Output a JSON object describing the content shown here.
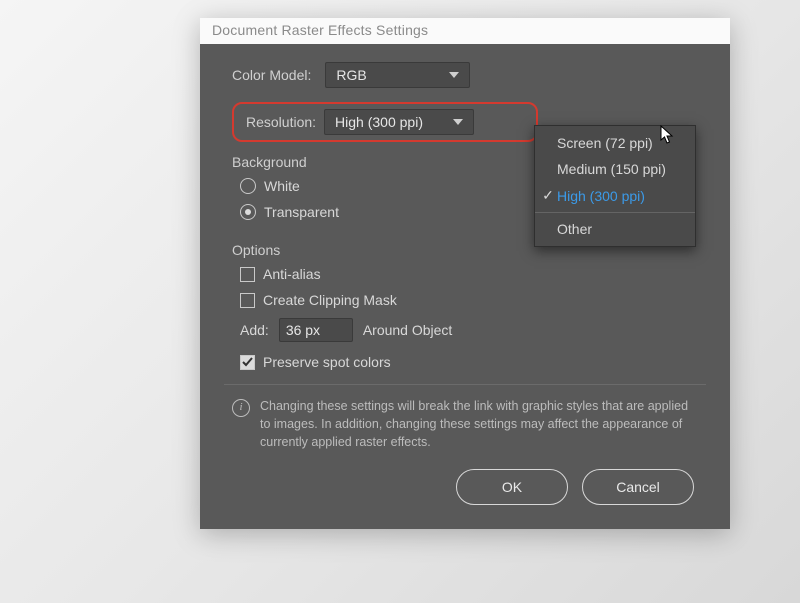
{
  "dialog": {
    "title": "Document Raster Effects Settings",
    "color_model": {
      "label": "Color Model:",
      "value": "RGB"
    },
    "resolution": {
      "label": "Resolution:",
      "value": "High (300 ppi)",
      "options": [
        "Screen (72 ppi)",
        "Medium (150 ppi)",
        "High (300 ppi)",
        "Other"
      ],
      "selected_index": 2
    },
    "background": {
      "title": "Background",
      "white": "White",
      "transparent": "Transparent",
      "selected": "transparent"
    },
    "options": {
      "title": "Options",
      "anti_alias": "Anti-alias",
      "clipping_mask": "Create Clipping Mask",
      "add_label": "Add:",
      "add_value": "36 px",
      "around": "Around Object",
      "preserve_spot": "Preserve spot colors",
      "anti_alias_checked": false,
      "clipping_mask_checked": false,
      "preserve_spot_checked": true
    },
    "warning": "Changing these settings will break the link with graphic styles that are applied to images. In addition, changing these settings may affect the appearance of currently applied raster effects.",
    "buttons": {
      "ok": "OK",
      "cancel": "Cancel"
    }
  }
}
